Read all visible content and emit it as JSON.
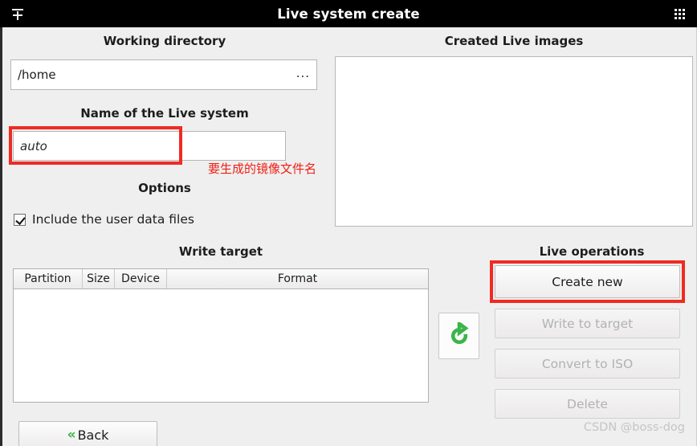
{
  "window": {
    "title": "Live system create",
    "left_icon": "add-stack-icon",
    "right_icon": "grid-dots-icon"
  },
  "working_directory": {
    "heading": "Working directory",
    "value": "/home",
    "browse_label": "...",
    "browse_icon": "ellipsis-icon"
  },
  "live_name": {
    "heading": "Name of the Live system",
    "value": "auto",
    "placeholder": "auto"
  },
  "options": {
    "heading": "Options",
    "include_user_data": {
      "label": "Include the user data files",
      "checked": true
    }
  },
  "write_target": {
    "heading": "Write target",
    "columns": [
      "Partition",
      "Size",
      "Device",
      "Format"
    ],
    "rows": []
  },
  "created_images": {
    "heading": "Created Live images",
    "items": []
  },
  "live_operations": {
    "heading": "Live operations",
    "buttons": [
      {
        "label": "Create new",
        "enabled": true
      },
      {
        "label": "Write to target",
        "enabled": false
      },
      {
        "label": "Convert to ISO",
        "enabled": false
      },
      {
        "label": "Delete",
        "enabled": false
      }
    ]
  },
  "refresh": {
    "icon": "refresh-icon",
    "color": "#3cb44a"
  },
  "back": {
    "label": "Back",
    "icon": "double-chevron-left-icon"
  },
  "annotations": {
    "name_field_note": "要生成的镜像文件名",
    "color": "#ef2b22"
  },
  "watermark": {
    "text": "CSDN @boss-dog"
  }
}
